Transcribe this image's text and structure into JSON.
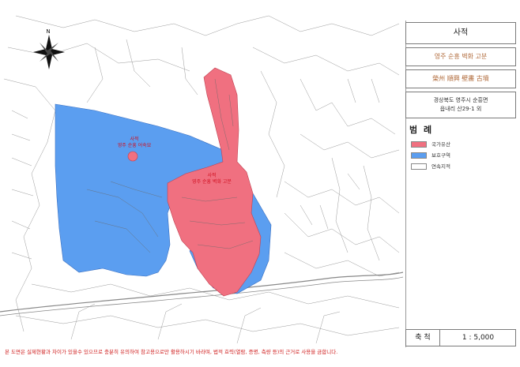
{
  "title": "사적",
  "site_name_ko": "영주 순흥 벽화 고분",
  "site_name_hanja": "榮州 順興 壁畵 古墳",
  "address_line1": "경상북도 영주시 순흥면",
  "address_line2": "읍내리 산29-1 외",
  "legend": {
    "title": "범 례",
    "items": [
      {
        "label": "국가유산",
        "color": "#f07080"
      },
      {
        "label": "보호구역",
        "color": "#5b9ef0"
      },
      {
        "label": "연속지적",
        "color": "#ffffff"
      }
    ]
  },
  "scale": {
    "label": "축 척",
    "value": "1 : 5,000"
  },
  "north_label": "N",
  "map_labels": {
    "site1_line1": "사적",
    "site1_line2": "영주 순흥 어숙묘",
    "site2_line1": "사적",
    "site2_line2": "영주 순흥 벽화 고분"
  },
  "footer": "본 도면은 실제현황과 차이가 있을수 있으므로 충분히 유의하여 참고용으로만 활용하시기 바라며, 법적 효력(열람, 증명, 측량 등)의 근거로 사용을 금합니다.",
  "colors": {
    "heritage": "#f07080",
    "protection": "#5b9ef0",
    "site_label": "#d01020"
  }
}
